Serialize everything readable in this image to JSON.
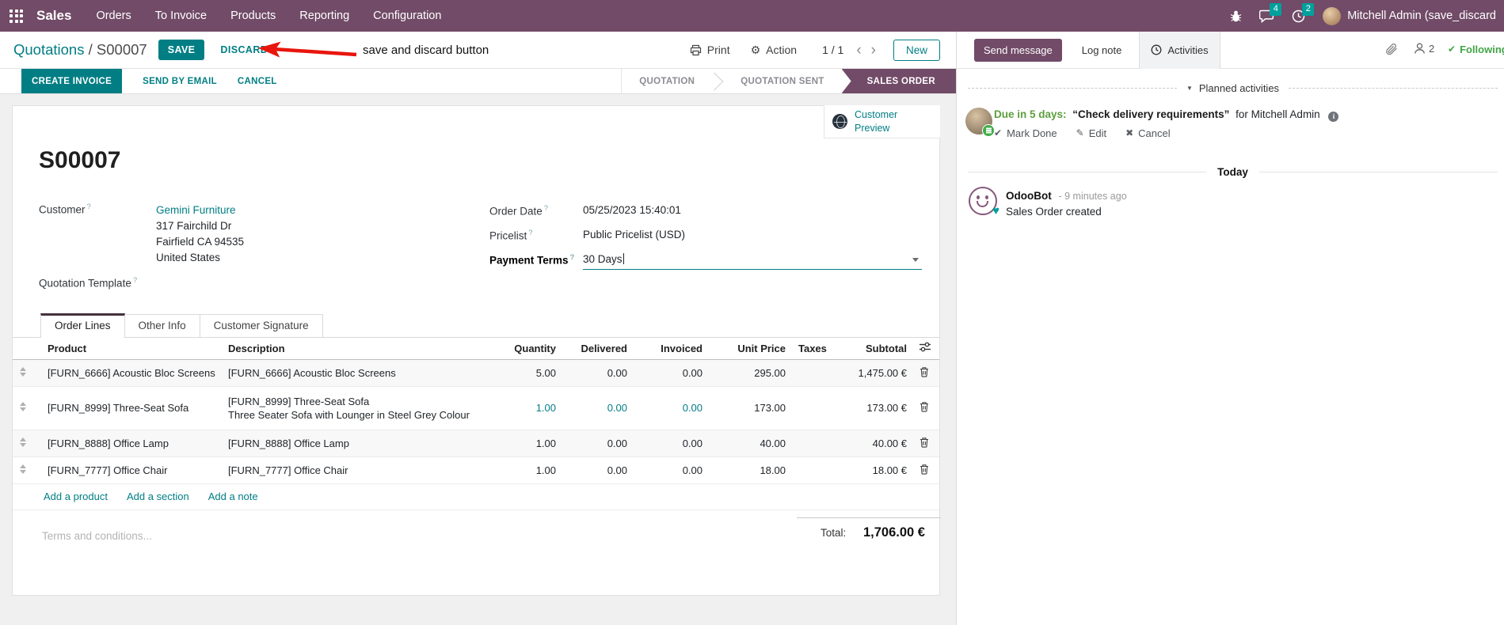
{
  "colors": {
    "brand_purple": "#714B67",
    "accent_teal": "#017E84",
    "badge_teal": "#00A09D",
    "following_green": "#42a548",
    "due_green": "#5d9e3d",
    "annotation_red": "#e8150d"
  },
  "icons": {
    "gear": "⚙",
    "prev": "‹",
    "next": "›",
    "check": "✔",
    "pencil": "✎",
    "cross": "✖",
    "heart": "♥",
    "caret_down": "▼",
    "info": "i"
  },
  "navbar": {
    "app_name": "Sales",
    "menus": [
      "Orders",
      "To Invoice",
      "Products",
      "Reporting",
      "Configuration"
    ],
    "messages_badge": "4",
    "activities_badge": "2",
    "user_name": "Mitchell Admin (save_discard"
  },
  "control_panel": {
    "breadcrumb_parent": "Quotations",
    "breadcrumb_separator": "/",
    "breadcrumb_current": "S00007",
    "save_label": "SAVE",
    "discard_label": "DISCARD",
    "print_label": "Print",
    "action_label": "Action",
    "pager": "1 / 1",
    "new_label": "New"
  },
  "annotation": {
    "text": "save and discard button"
  },
  "statusbar": {
    "create_invoice": "CREATE INVOICE",
    "send_by_email": "SEND BY EMAIL",
    "cancel": "CANCEL",
    "stages": [
      "QUOTATION",
      "QUOTATION SENT",
      "SALES ORDER"
    ],
    "active_stage": "SALES ORDER"
  },
  "form": {
    "title": "S00007",
    "customer_preview_label": "Customer Preview",
    "help_marker": "?",
    "customer_label": "Customer",
    "customer_name": "Gemini Furniture",
    "address_line1": "317 Fairchild Dr",
    "address_line2": "Fairfield CA 94535",
    "address_line3": "United States",
    "quotation_template_label": "Quotation Template",
    "order_date_label": "Order Date",
    "order_date_value": "05/25/2023 15:40:01",
    "pricelist_label": "Pricelist",
    "pricelist_value": "Public Pricelist (USD)",
    "payment_terms_label": "Payment Terms",
    "payment_terms_value": "30 Days",
    "tabs": [
      "Order Lines",
      "Other Info",
      "Customer Signature"
    ],
    "active_tab": "Order Lines",
    "table": {
      "headers": [
        "Product",
        "Description",
        "Quantity",
        "Delivered",
        "Invoiced",
        "Unit Price",
        "Taxes",
        "Subtotal"
      ],
      "rows": [
        {
          "product": "[FURN_6666] Acoustic Bloc Screens",
          "description": "[FURN_6666] Acoustic Bloc Screens",
          "quantity": "5.00",
          "delivered": "0.00",
          "invoiced": "0.00",
          "unit_price": "295.00",
          "taxes": "",
          "subtotal": "1,475.00 €"
        },
        {
          "product": "[FURN_8999] Three-Seat Sofa",
          "description": "[FURN_8999] Three-Seat Sofa",
          "description2": "Three Seater Sofa with Lounger in Steel Grey Colour",
          "quantity": "1.00",
          "delivered": "0.00",
          "invoiced": "0.00",
          "unit_price": "173.00",
          "taxes": "",
          "subtotal": "173.00 €"
        },
        {
          "product": "[FURN_8888] Office Lamp",
          "description": "[FURN_8888] Office Lamp",
          "quantity": "1.00",
          "delivered": "0.00",
          "invoiced": "0.00",
          "unit_price": "40.00",
          "taxes": "",
          "subtotal": "40.00 €"
        },
        {
          "product": "[FURN_7777] Office Chair",
          "description": "[FURN_7777] Office Chair",
          "quantity": "1.00",
          "delivered": "0.00",
          "invoiced": "0.00",
          "unit_price": "18.00",
          "taxes": "",
          "subtotal": "18.00 €"
        }
      ],
      "add_product": "Add a product",
      "add_section": "Add a section",
      "add_note": "Add a note"
    },
    "terms_placeholder": "Terms and conditions...",
    "total_label": "Total:",
    "total_value": "1,706.00 €"
  },
  "chatter": {
    "send_message": "Send message",
    "log_note": "Log note",
    "activities_tab": "Activities",
    "followers_count": "2",
    "following_label": "Following",
    "planned_activities_header": "Planned activities",
    "activity": {
      "due": "Due in 5 days:",
      "summary": "“Check delivery requirements”",
      "assignee": "for Mitchell Admin",
      "mark_done": "Mark Done",
      "edit": "Edit",
      "cancel": "Cancel"
    },
    "today_separator": "Today",
    "message": {
      "author": "OdooBot",
      "timestamp": "- 9 minutes ago",
      "body": "Sales Order created"
    }
  }
}
